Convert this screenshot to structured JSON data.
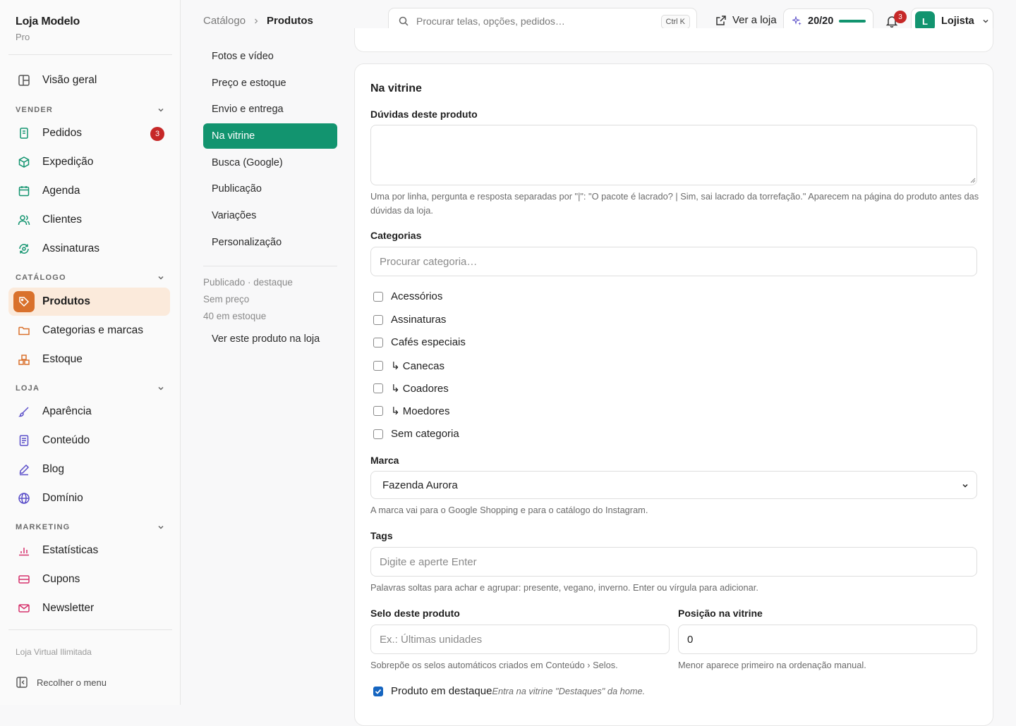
{
  "sidebar": {
    "brand_title": "Loja Modelo",
    "brand_plan": "Pro",
    "overview": "Visão geral",
    "sections": {
      "vender": "VENDER",
      "catalogo": "CATÁLOGO",
      "loja": "LOJA",
      "marketing": "MARKETING"
    },
    "items": {
      "pedidos": "Pedidos",
      "pedidos_badge": "3",
      "expedicao": "Expedição",
      "agenda": "Agenda",
      "clientes": "Clientes",
      "assinaturas": "Assinaturas",
      "produtos": "Produtos",
      "categorias": "Categorias e marcas",
      "estoque": "Estoque",
      "aparencia": "Aparência",
      "conteudo": "Conteúdo",
      "blog": "Blog",
      "dominio": "Domínio",
      "estatisticas": "Estatísticas",
      "cupons": "Cupons",
      "newsletter": "Newsletter"
    },
    "footer_plan": "Loja Virtual Ilimitada",
    "collapse": "Recolher o menu"
  },
  "header": {
    "breadcrumb_parent": "Catálogo",
    "breadcrumb_current": "Produtos",
    "search_placeholder": "Procurar telas, opções, pedidos…",
    "search_shortcut": "Ctrl K",
    "view_store": "Ver a loja",
    "quota_label": "20/20",
    "quota_fraction": 1.0,
    "notifications_count": "3",
    "avatar_letter": "L",
    "user_name": "Lojista"
  },
  "subnav": {
    "items": [
      "Fotos e vídeo",
      "Preço e estoque",
      "Envio e entrega",
      "Na vitrine",
      "Busca (Google)",
      "Publicação",
      "Variações",
      "Personalização"
    ],
    "active_index": 3,
    "meta": [
      "Publicado · destaque",
      "Sem preço",
      "40 em estoque"
    ],
    "view_link": "Ver este produto na loja"
  },
  "form": {
    "section_title": "Na vitrine",
    "faq_label": "Dúvidas deste produto",
    "faq_value": "",
    "faq_help": "Uma por linha, pergunta e resposta separadas por \"|\": \"O pacote é lacrado? | Sim, sai lacrado da torrefação.\" Aparecem na página do produto antes das dúvidas da loja.",
    "categories_label": "Categorias",
    "categories_placeholder": "Procurar categoria…",
    "categories": [
      {
        "label": "Acessórios",
        "checked": false
      },
      {
        "label": "Assinaturas",
        "checked": false
      },
      {
        "label": "Cafés especiais",
        "checked": false
      },
      {
        "label": "↳ Canecas",
        "checked": false
      },
      {
        "label": "↳ Coadores",
        "checked": false
      },
      {
        "label": "↳ Moedores",
        "checked": false
      },
      {
        "label": "Sem categoria",
        "checked": false
      }
    ],
    "brand_label": "Marca",
    "brand_value": "Fazenda Aurora",
    "brand_help": "A marca vai para o Google Shopping e para o catálogo do Instagram.",
    "tags_label": "Tags",
    "tags_placeholder": "Digite e aperte Enter",
    "tags_help": "Palavras soltas para achar e agrupar: presente, vegano, inverno. Enter ou vírgula para adicionar.",
    "seal_label": "Selo deste produto",
    "seal_placeholder": "Ex.: Últimas unidades",
    "seal_help": "Sobrepõe os selos automáticos criados em Conteúdo › Selos.",
    "position_label": "Posição na vitrine",
    "position_value": "0",
    "position_help": "Menor aparece primeiro na ordenação manual.",
    "featured_label": "Produto em destaque",
    "featured_checked": true,
    "featured_help": "Entra na vitrine \"Destaques\" da home."
  },
  "colors": {
    "accent_green": "#12946f",
    "accent_orange": "#d9712c",
    "badge_red": "#c62828"
  }
}
